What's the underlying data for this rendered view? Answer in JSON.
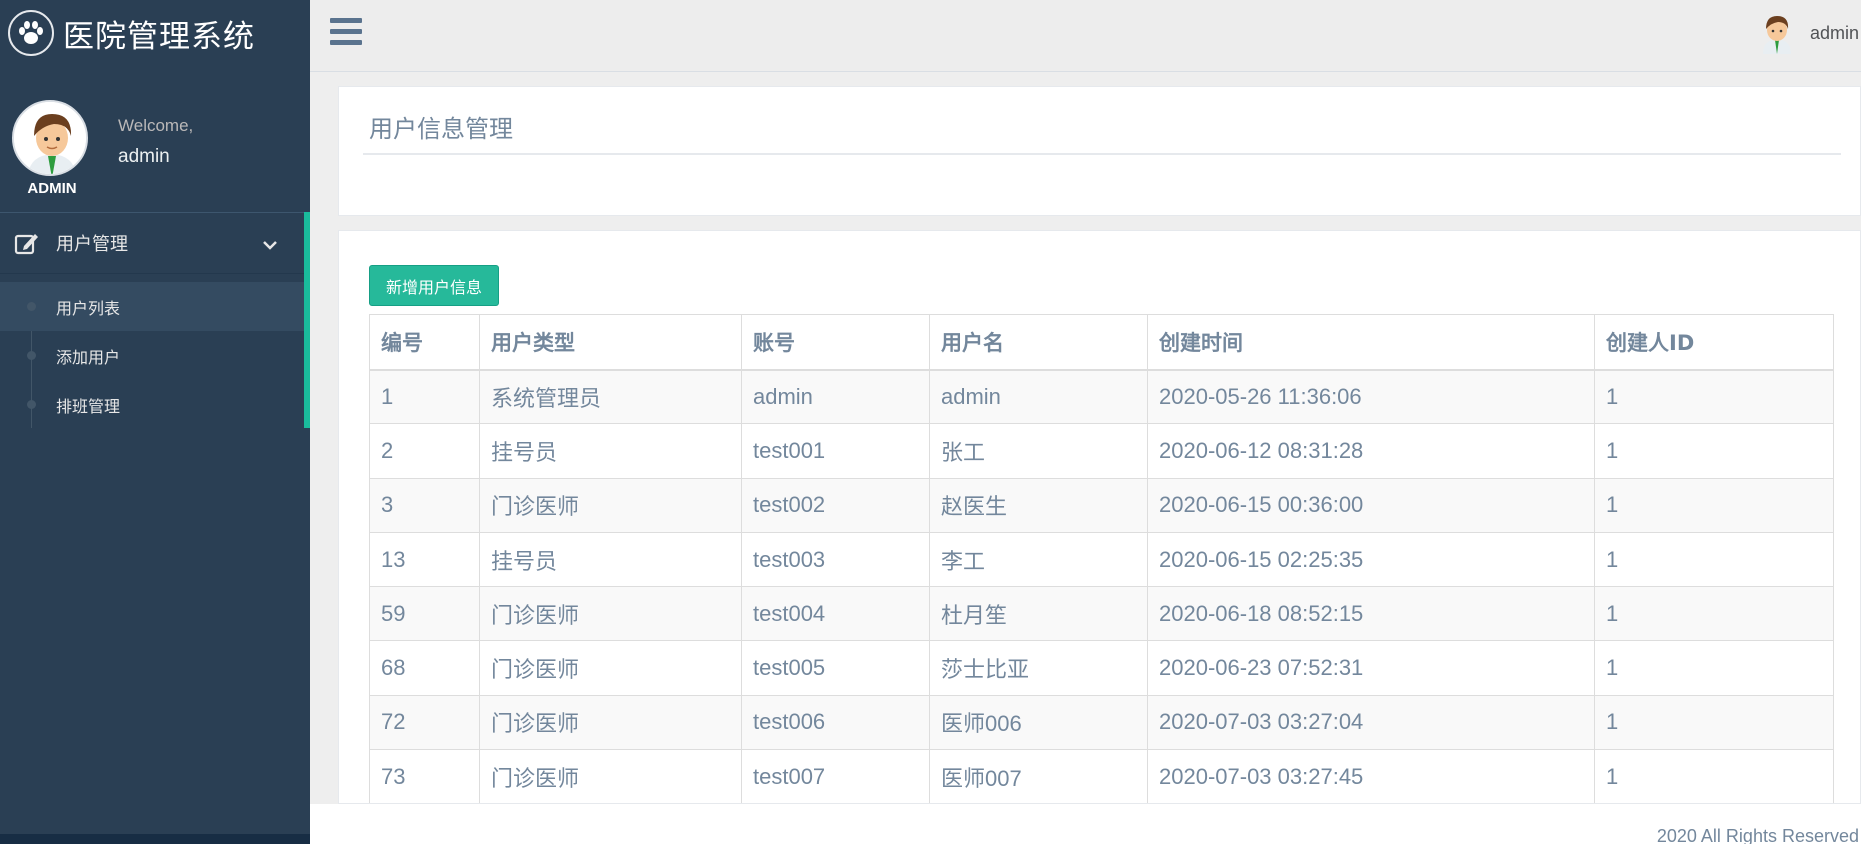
{
  "brand": {
    "title": "医院管理系统",
    "icon": "paw-icon"
  },
  "profile": {
    "welcome": "Welcome,",
    "name": "admin",
    "role_tag": "ADMIN"
  },
  "menu": {
    "section_label": "用户管理",
    "section_icon": "edit-icon",
    "items": [
      {
        "label": "用户列表",
        "active": true
      },
      {
        "label": "添加用户",
        "active": false
      },
      {
        "label": "排班管理",
        "active": false
      }
    ]
  },
  "topbar": {
    "username": "admin"
  },
  "page": {
    "title": "用户信息管理",
    "add_button": "新增用户信息"
  },
  "table": {
    "headers": [
      "编号",
      "用户类型",
      "账号",
      "用户名",
      "创建时间",
      "创建人ID"
    ],
    "rows": [
      [
        "1",
        "系统管理员",
        "admin",
        "admin",
        "2020-05-26 11:36:06",
        "1"
      ],
      [
        "2",
        "挂号员",
        "test001",
        "张工",
        "2020-06-12 08:31:28",
        "1"
      ],
      [
        "3",
        "门诊医师",
        "test002",
        "赵医生",
        "2020-06-15 00:36:00",
        "1"
      ],
      [
        "13",
        "挂号员",
        "test003",
        "李工",
        "2020-06-15 02:25:35",
        "1"
      ],
      [
        "59",
        "门诊医师",
        "test004",
        "杜月笙",
        "2020-06-18 08:52:15",
        "1"
      ],
      [
        "68",
        "门诊医师",
        "test005",
        "莎士比亚",
        "2020-06-23 07:52:31",
        "1"
      ],
      [
        "72",
        "门诊医师",
        "test006",
        "医师006",
        "2020-07-03 03:27:04",
        "1"
      ],
      [
        "73",
        "门诊医师",
        "test007",
        "医师007",
        "2020-07-03 03:27:45",
        "1"
      ]
    ]
  },
  "footer": {
    "text": "2020 All Rights Reserved"
  },
  "colors": {
    "sidebar": "#2a3f54",
    "accent": "#1abb9c",
    "button": "#26b99a"
  }
}
